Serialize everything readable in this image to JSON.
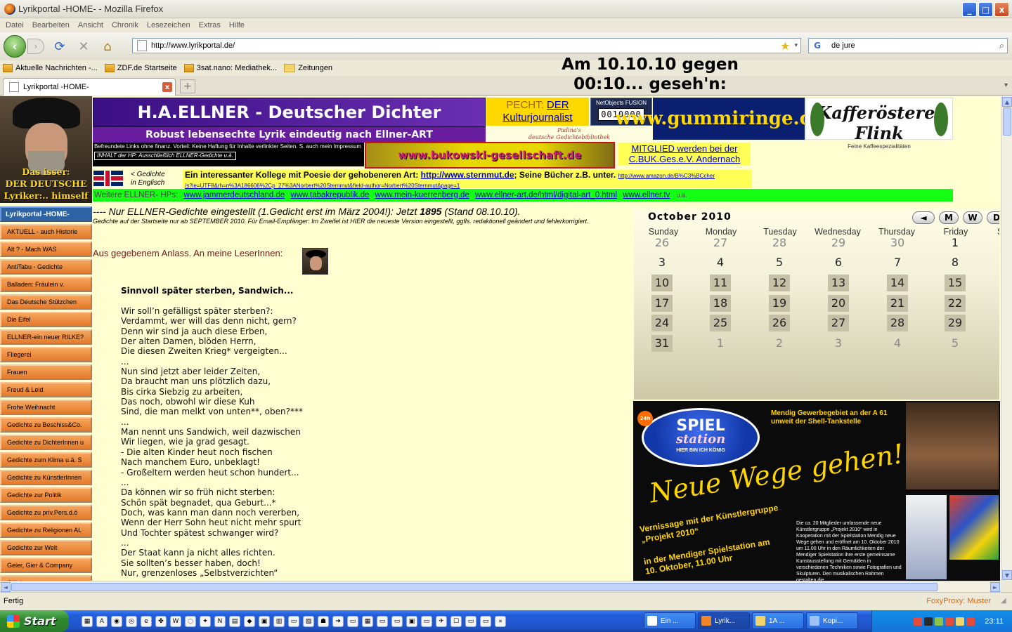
{
  "window": {
    "title": "Lyrikportal -HOME- - Mozilla Firefox",
    "btn_min": "_",
    "btn_max": "□",
    "btn_close": "x"
  },
  "menu": [
    "Datei",
    "Bearbeiten",
    "Ansicht",
    "Chronik",
    "Lesezeichen",
    "Extras",
    "Hilfe"
  ],
  "nav": {
    "url": "http://www.lyrikportal.de/",
    "search_query": "de jure",
    "back": "‹",
    "forward": "›",
    "reload": "⟳",
    "stop": "✕",
    "home": "⌂",
    "star": "★",
    "drop": "▾",
    "google": "G",
    "magnifier": "⌕"
  },
  "bookmarks": [
    "Aktuelle Nachrichten -...",
    "ZDF.de Startseite",
    "3sat.nano: Mediathek...",
    "Zeitungen"
  ],
  "overlay_date": {
    "line1": "Am 10.10.10 gegen",
    "line2": "00:10... geseh'n:"
  },
  "tab": {
    "title": "Lyrikportal -HOME-",
    "close": "x",
    "new": "+",
    "list": "▾"
  },
  "portrait": {
    "caption1": "Das isser:",
    "caption2": "DER DEUTSCHE",
    "caption3": "Lyriker:.. himself"
  },
  "sidenav": {
    "head": "Lyrikportal -HOME-",
    "items": [
      "AKTUELL - auch Historie",
      "Alt ? - Mach WAS",
      "AntiTabu - Gedichte",
      "Balladen: Fräulein v.",
      "Das Deutsche Stützchen",
      "Die Eifel",
      "ELLNER-ein neuer RILKE?",
      "Fliegerei",
      "Frauen",
      "Freud & Leid",
      "Frohe Weihnacht",
      "Gedichte zu Beschiss&Co.",
      "Gedichte zu DichterInnen u",
      "Gedichte zum Klima u.ä. S",
      "Gedichte zu KünstlerInnen",
      "Gedichte zur Politik",
      "Gedichte zu priv.Pers.d.ö",
      "Gedichte zu Religionen  AL",
      "Gedichte zur Welt",
      "Geier, Gier & Company",
      "Glück"
    ]
  },
  "header": {
    "main": "H.A.ELLNER - Deutscher Dichter",
    "sub": "Robust lebensechte Lyrik eindeutig nach Ellner-ART",
    "pecht_1": "PECHT:",
    "pecht_link1": "DER",
    "pecht_link2": "Kulturjournalist",
    "padina_1": "Padina's",
    "padina_2": "deutsche Gedichtebibliothek",
    "counter_label": "NetObjects FUSION",
    "counter_value": "0010000",
    "gummi": "www.gummiringe.com",
    "kaffee_1": "Kafferösterei Flink",
    "kaffee_2": "Feine Kaffeespezialitäten"
  },
  "strip": {
    "befreundete": "Befreundete Links ohne finanz. Vorteil: Keine Haftung für Inhalte verlinkter Seiten. S. auch mein Impressum",
    "inhalt": "INHALT der HP: Ausschließlich ELLNER-Gedichte  u.ä.",
    "bukowski": "www.bukowski-gesellschaft.de",
    "mitglied_1": "MITGLIED werden bei der",
    "mitglied_2": "C.BUK.Ges.e.V. Andernach"
  },
  "english": {
    "l1": "< Gedichte",
    "l2": "in Englisch"
  },
  "kollege": {
    "text": "Ein interessanter Kollege mit Poesie der gehobeneren Art:",
    "link": "http://www.sternmut.de",
    "text2": "; Seine Bücher z.B. unter.",
    "amazon": "http://www.amazon.de/B%C3%BCcher",
    "amazon2": "/s?ie=UTF8&rh=n%3A186606%2Cp_27%3ANorbert%20Sternmut&field-author=Norbert%20Sternmut&page=1"
  },
  "weitere": {
    "label": "Weitere ELLNER- HPs:",
    "links": [
      "www.jammerdeutschland.de",
      "www.tabakrepublik.de",
      "www.mein-kuerrenberg.de",
      "www.ellner-art.de/html/digital-art_0.html",
      "www.ellner.tv"
    ],
    "ua": "u.ä."
  },
  "intro": {
    "a": "---- Nur ELLNER-Gedichte eingestellt (1.Gedicht erst im März 2004!): Jetzt ",
    "count": "1895",
    "b": " (Stand 08.10.10).",
    "small": "Gedichte auf der Startseite nur ab SEPTEMBER 2010. Für Email-Empfänger: Im Zweifel ist HIER die neueste Version eingestellt, ggfls. redaktionell geändert und fehlerkorrigiert.",
    "anlass": "Aus gegebenem Anlass. An meine LeserInnen:"
  },
  "poem": {
    "title": "Sinnvoll später sterben, Sandwich...",
    "body": "Wir soll’n gefälligst später sterben?:\nVerdammt, wer will das denn nicht, gern?\nDenn wir sind ja auch diese Erben,\nDer alten Damen, blöden Herrn,\nDie diesen Zweiten Krieg* vergeigten...\n...\nNun sind jetzt aber leider Zeiten,\nDa braucht man uns plötzlich dazu,\nBis cirka Siebzig zu arbeiten,\nDas noch, obwohl wir diese Kuh\nSind, die man melkt von unten**, oben?***\n...\nMan nennt uns Sandwich, weil dazwischen\nWir liegen, wie ja grad gesagt.\n- Die alten Kinder heut noch fischen\nNach manchem Euro, unbeklagt!\n- Großeltern werden heut schon hundert...\n...\nDa können wir so früh nicht sterben:\nSchön spät begnadet, qua Geburt...*\nDoch, was kann man dann noch vererben,\nWenn der Herr Sohn heut nicht mehr spurt\nUnd Tochter spätest schwanger wird?\n...\nDer Staat kann ja nicht alles richten.\nSie sollten’s besser haben, doch!\nNur, grenzenloses „Selbstverzichten“"
  },
  "calendar": {
    "title": "October  2010",
    "btn_prev": "◄",
    "btn_m": "M",
    "btn_w": "W",
    "btn_d": "D",
    "dows": [
      "Sunday",
      "Monday",
      "Tuesday",
      "Wednesday",
      "Thursday",
      "Friday",
      "Saturday"
    ],
    "weeks": [
      [
        "26",
        "27",
        "28",
        "29",
        "30",
        "1"
      ],
      [
        "3",
        "4",
        "5",
        "6",
        "7",
        "8"
      ],
      [
        "10",
        "11",
        "12",
        "13",
        "14",
        "15"
      ],
      [
        "17",
        "18",
        "19",
        "20",
        "21",
        "22"
      ],
      [
        "24",
        "25",
        "26",
        "27",
        "28",
        "29"
      ],
      [
        "31",
        "1",
        "2",
        "3",
        "4",
        "5"
      ]
    ]
  },
  "ad": {
    "badge": "24h",
    "spiel1": "SPIEL",
    "spiel2": "station",
    "spiel3": "HIER BIN ICH KÖNIG",
    "mendig": "Mendig Gewerbegebiet an der A 61 unweit der Shell-Tankstelle",
    "neue": "Neue Wege gehen!",
    "verni": "Vernissage mit der Künstlergruppe „Projekt 2010“",
    "datum": "in der Mendiger Spielstation am 10. Oktober, 11.00 Uhr",
    "body": "Die ca. 20 Mitglieder umfassende neue Künstlergruppe „Projekt 2010“ wird in Kooperation mit der Spielstation Mendig neue Wege gehen und eröffnet am 10. Oktober 2010 um 11.00 Uhr in den Räumlichkeiten der Mendiger Spielstation ihre erste gemeinsame Kunstausstellung mit Gemälden in verschiedenen Techniken sowie Fotografien und Skulpturen. Den musikalischen Rahmen gestalten die"
  },
  "status": {
    "text": "Fertig",
    "proxy": "FoxyProxy: Muster",
    "grip": "◢"
  },
  "scroll": {
    "up": "▲",
    "down": "▼",
    "left": "◄",
    "right": "►"
  },
  "taskbar": {
    "start": "Start",
    "quick": [
      "▦",
      "A",
      "◉",
      "◎",
      "e",
      "✤",
      "W",
      "◌",
      "✦",
      "N",
      "▤",
      "◆",
      "▣",
      "▥",
      "▭",
      "▧",
      "☗",
      "➜",
      "▭",
      "▦",
      "▭",
      "▭",
      "▣",
      "▭",
      "✈",
      "☐",
      "▭",
      "▭",
      "»"
    ],
    "tasks": [
      "Ein ...",
      "Lyrik...",
      "1A ...",
      "Kopi..."
    ],
    "clock": "23:11"
  }
}
